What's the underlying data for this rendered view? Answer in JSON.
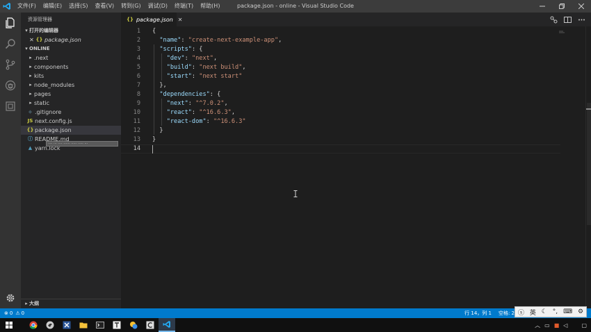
{
  "titlebar": {
    "menus": [
      "文件(F)",
      "编辑(E)",
      "选择(S)",
      "查看(V)",
      "转到(G)",
      "调试(D)",
      "终端(T)",
      "帮助(H)"
    ],
    "title": "package.json - online - Visual Studio Code"
  },
  "sidebar": {
    "title": "资源管理器",
    "open_editors": {
      "label": "打开的编辑器",
      "items": [
        {
          "name": "package.json",
          "icon": "{}"
        }
      ]
    },
    "folder": {
      "label": "ONLINE",
      "items": [
        {
          "name": ".next",
          "type": "folder"
        },
        {
          "name": "components",
          "type": "folder"
        },
        {
          "name": "kits",
          "type": "folder"
        },
        {
          "name": "node_modules",
          "type": "folder"
        },
        {
          "name": "pages",
          "type": "folder"
        },
        {
          "name": "static",
          "type": "folder"
        },
        {
          "name": ".gitignore",
          "type": "file",
          "icon": "◆"
        },
        {
          "name": "next.config.js",
          "type": "file",
          "icon": "JS"
        },
        {
          "name": "package.json",
          "type": "file",
          "icon": "{}"
        },
        {
          "name": "README.md",
          "type": "file",
          "icon": "ⓘ"
        },
        {
          "name": "yarn.lock",
          "type": "file",
          "icon": "▲"
        }
      ]
    },
    "outline": {
      "label": "大纲"
    }
  },
  "editor": {
    "tab": {
      "label": "package.json",
      "icon": "{}"
    },
    "active_line": 14,
    "lines": [
      {
        "n": "1",
        "tokens": [
          {
            "t": "{",
            "c": "p"
          }
        ]
      },
      {
        "n": "2",
        "tokens": [
          {
            "t": "  ",
            "c": "p"
          },
          {
            "t": "\"name\"",
            "c": "k"
          },
          {
            "t": ": ",
            "c": "p"
          },
          {
            "t": "\"create-next-example-app\"",
            "c": "s"
          },
          {
            "t": ",",
            "c": "p"
          }
        ]
      },
      {
        "n": "3",
        "tokens": [
          {
            "t": "  ",
            "c": "p"
          },
          {
            "t": "\"scripts\"",
            "c": "k"
          },
          {
            "t": ": {",
            "c": "p"
          }
        ]
      },
      {
        "n": "4",
        "tokens": [
          {
            "t": "    ",
            "c": "p"
          },
          {
            "t": "\"dev\"",
            "c": "k"
          },
          {
            "t": ": ",
            "c": "p"
          },
          {
            "t": "\"next\"",
            "c": "s"
          },
          {
            "t": ",",
            "c": "p"
          }
        ]
      },
      {
        "n": "5",
        "tokens": [
          {
            "t": "    ",
            "c": "p"
          },
          {
            "t": "\"build\"",
            "c": "k"
          },
          {
            "t": ": ",
            "c": "p"
          },
          {
            "t": "\"next build\"",
            "c": "s"
          },
          {
            "t": ",",
            "c": "p"
          }
        ]
      },
      {
        "n": "6",
        "tokens": [
          {
            "t": "    ",
            "c": "p"
          },
          {
            "t": "\"start\"",
            "c": "k"
          },
          {
            "t": ": ",
            "c": "p"
          },
          {
            "t": "\"next start\"",
            "c": "s"
          }
        ]
      },
      {
        "n": "7",
        "tokens": [
          {
            "t": "  },",
            "c": "p"
          }
        ]
      },
      {
        "n": "8",
        "tokens": [
          {
            "t": "  ",
            "c": "p"
          },
          {
            "t": "\"dependencies\"",
            "c": "k"
          },
          {
            "t": ": {",
            "c": "p"
          }
        ]
      },
      {
        "n": "9",
        "tokens": [
          {
            "t": "    ",
            "c": "p"
          },
          {
            "t": "\"next\"",
            "c": "k"
          },
          {
            "t": ": ",
            "c": "p"
          },
          {
            "t": "\"^7.0.2\"",
            "c": "s"
          },
          {
            "t": ",",
            "c": "p"
          }
        ]
      },
      {
        "n": "10",
        "tokens": [
          {
            "t": "    ",
            "c": "p"
          },
          {
            "t": "\"react\"",
            "c": "k"
          },
          {
            "t": ": ",
            "c": "p"
          },
          {
            "t": "\"^16.6.3\"",
            "c": "s"
          },
          {
            "t": ",",
            "c": "p"
          }
        ]
      },
      {
        "n": "11",
        "tokens": [
          {
            "t": "    ",
            "c": "p"
          },
          {
            "t": "\"react-dom\"",
            "c": "k"
          },
          {
            "t": ": ",
            "c": "p"
          },
          {
            "t": "\"^16.6.3\"",
            "c": "s"
          }
        ]
      },
      {
        "n": "12",
        "tokens": [
          {
            "t": "  }",
            "c": "p"
          }
        ]
      },
      {
        "n": "13",
        "tokens": [
          {
            "t": "}",
            "c": "p"
          }
        ]
      },
      {
        "n": "14",
        "tokens": []
      }
    ]
  },
  "statusbar": {
    "errors": "0",
    "warnings": "0",
    "position": "行 14，列 1",
    "spaces": "空格: 2"
  },
  "ime": {
    "lang": "英"
  },
  "colors": {
    "accent": "#007acc",
    "activitybar": "#333333",
    "sidebar": "#252526",
    "editor": "#1e1e1e"
  }
}
